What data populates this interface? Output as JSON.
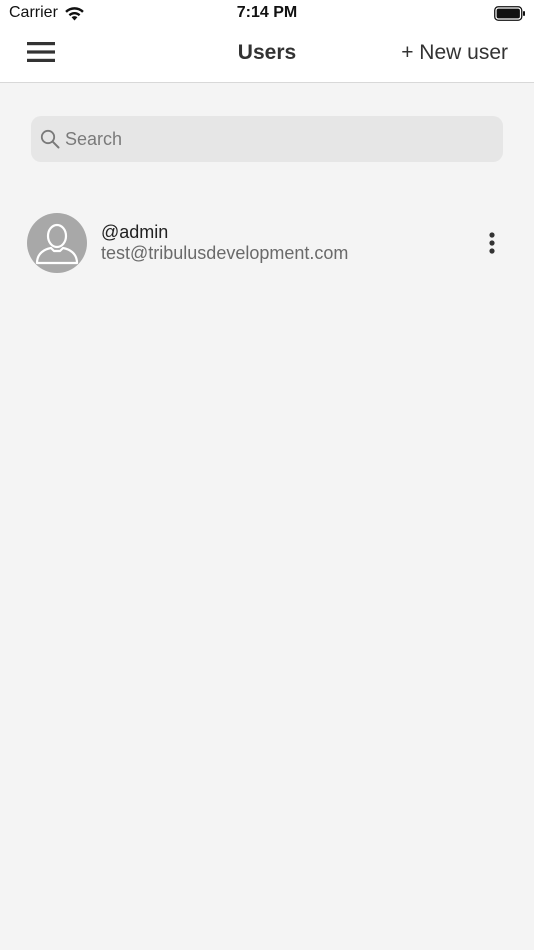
{
  "status_bar": {
    "carrier": "Carrier",
    "time": "7:14 PM",
    "wifi_icon": "wifi-icon",
    "battery_icon": "battery-icon"
  },
  "nav": {
    "menu_icon": "hamburger-menu-icon",
    "title": "Users",
    "new_user_label": "+ New user"
  },
  "search": {
    "placeholder": "Search",
    "value": "",
    "icon": "search-icon"
  },
  "users": [
    {
      "handle": "@admin",
      "email": "test@tribulusdevelopment.com",
      "avatar_icon": "default-avatar-icon",
      "more_icon": "vertical-ellipsis-icon"
    }
  ],
  "colors": {
    "background": "#f4f4f4",
    "bar_background": "#ffffff",
    "search_background": "#e6e6e6",
    "avatar_background": "#a8a8a8",
    "secondary_text": "#6a6a6a"
  }
}
